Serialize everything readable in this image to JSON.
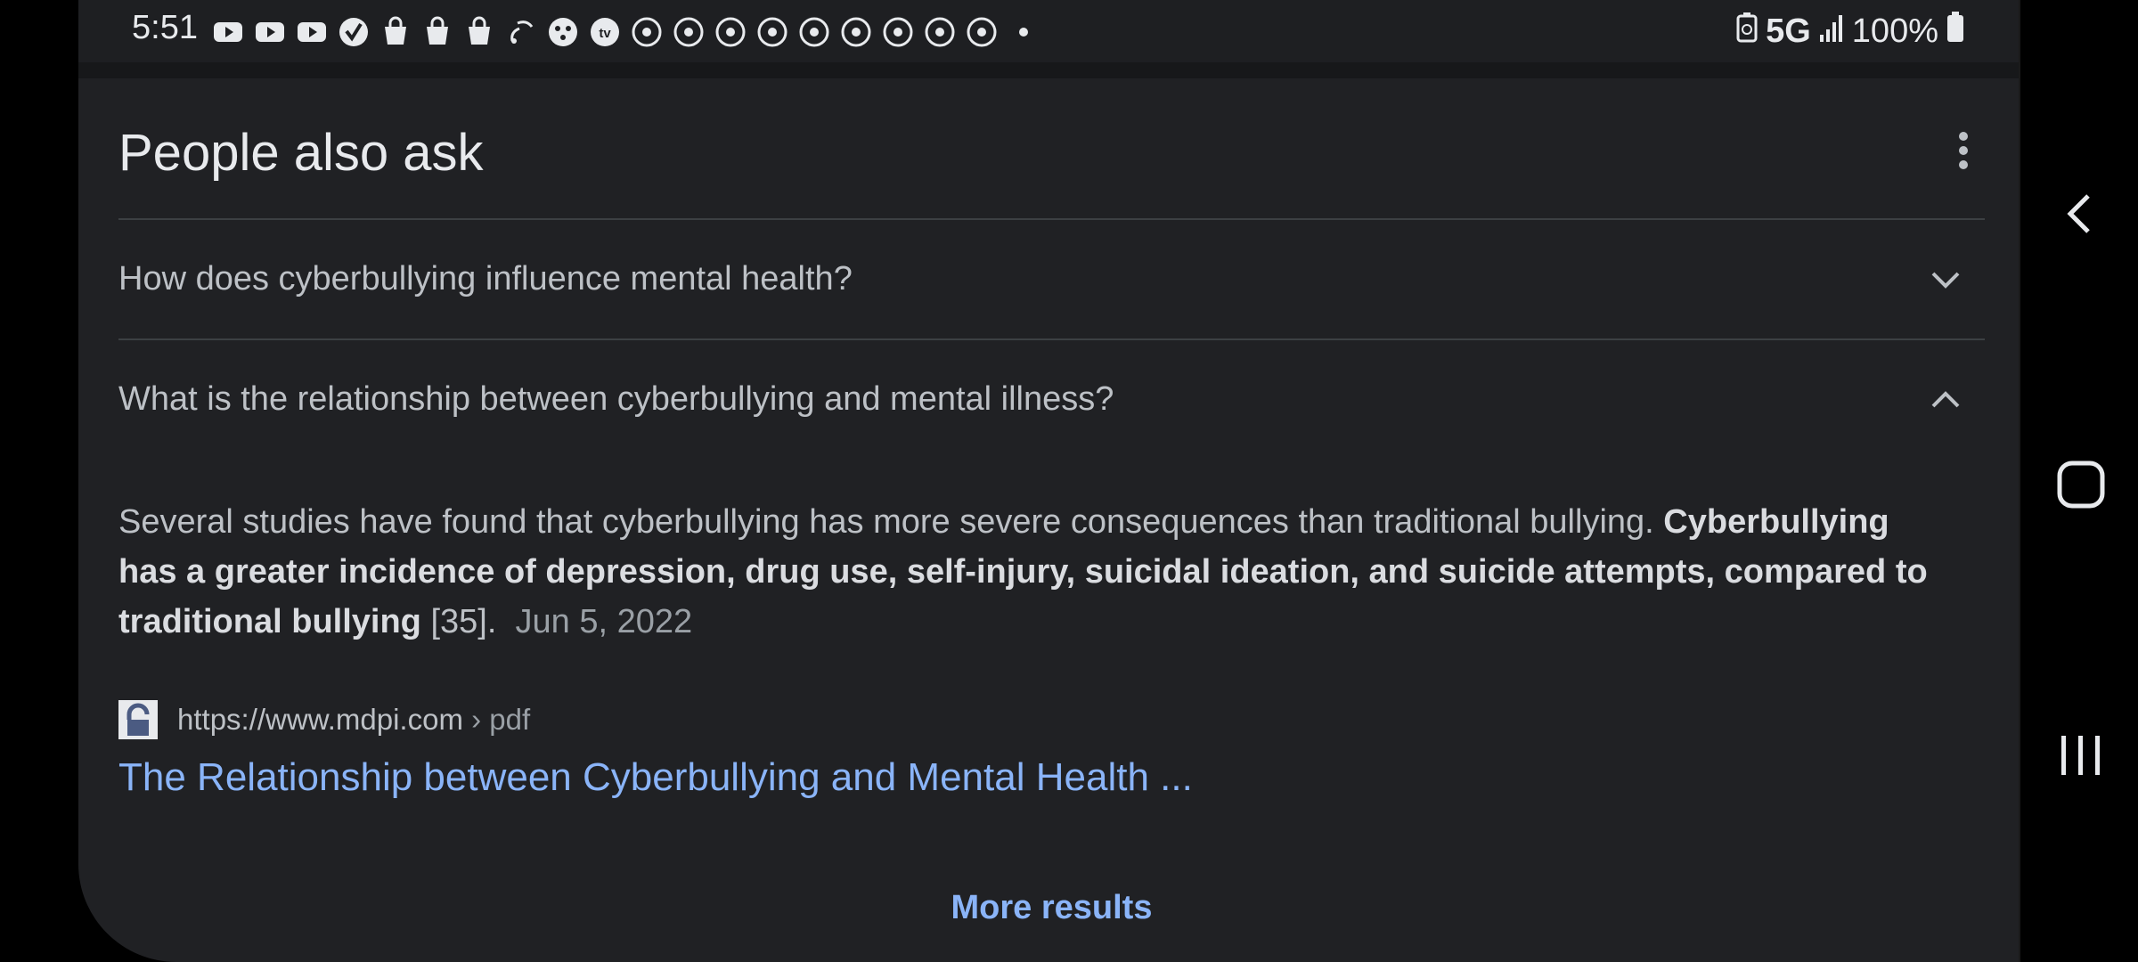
{
  "status_bar": {
    "time": "5:51",
    "network": "5G",
    "battery": "100%",
    "notification_icons": [
      "youtube-icon",
      "youtube-icon",
      "youtube-icon",
      "check-app-icon",
      "shopping-bag-icon",
      "shopping-bag-icon",
      "shopping-bag-icon",
      "wifi-call-icon",
      "game-icon",
      "tv-icon",
      "chrome-icon",
      "chrome-icon",
      "chrome-icon",
      "chrome-icon",
      "chrome-icon",
      "chrome-icon",
      "chrome-icon",
      "chrome-icon",
      "chrome-icon",
      "more-dot-icon"
    ]
  },
  "people_also_ask": {
    "title": "People also ask",
    "questions": [
      {
        "text": "How does cyberbullying influence mental health?",
        "expanded": false
      },
      {
        "text": "What is the relationship between cyberbullying and mental illness?",
        "expanded": true
      }
    ],
    "answer": {
      "plain": "Several studies have found that cyberbullying has more severe consequences than traditional bullying.",
      "bold": "Cyberbullying has a greater incidence of depression, drug use, self-injury, suicidal ideation, and suicide attempts, compared to traditional bullying",
      "ref": "[35].",
      "date": "Jun 5, 2022"
    },
    "source": {
      "url": "https://www.mdpi.com",
      "crumb": "› pdf",
      "title": "The Relationship between Cyberbullying and Mental Health ..."
    },
    "more_results": "More results"
  },
  "colors": {
    "background": "#202124",
    "link": "#8ab4f8",
    "text": "#bdc1c6"
  }
}
